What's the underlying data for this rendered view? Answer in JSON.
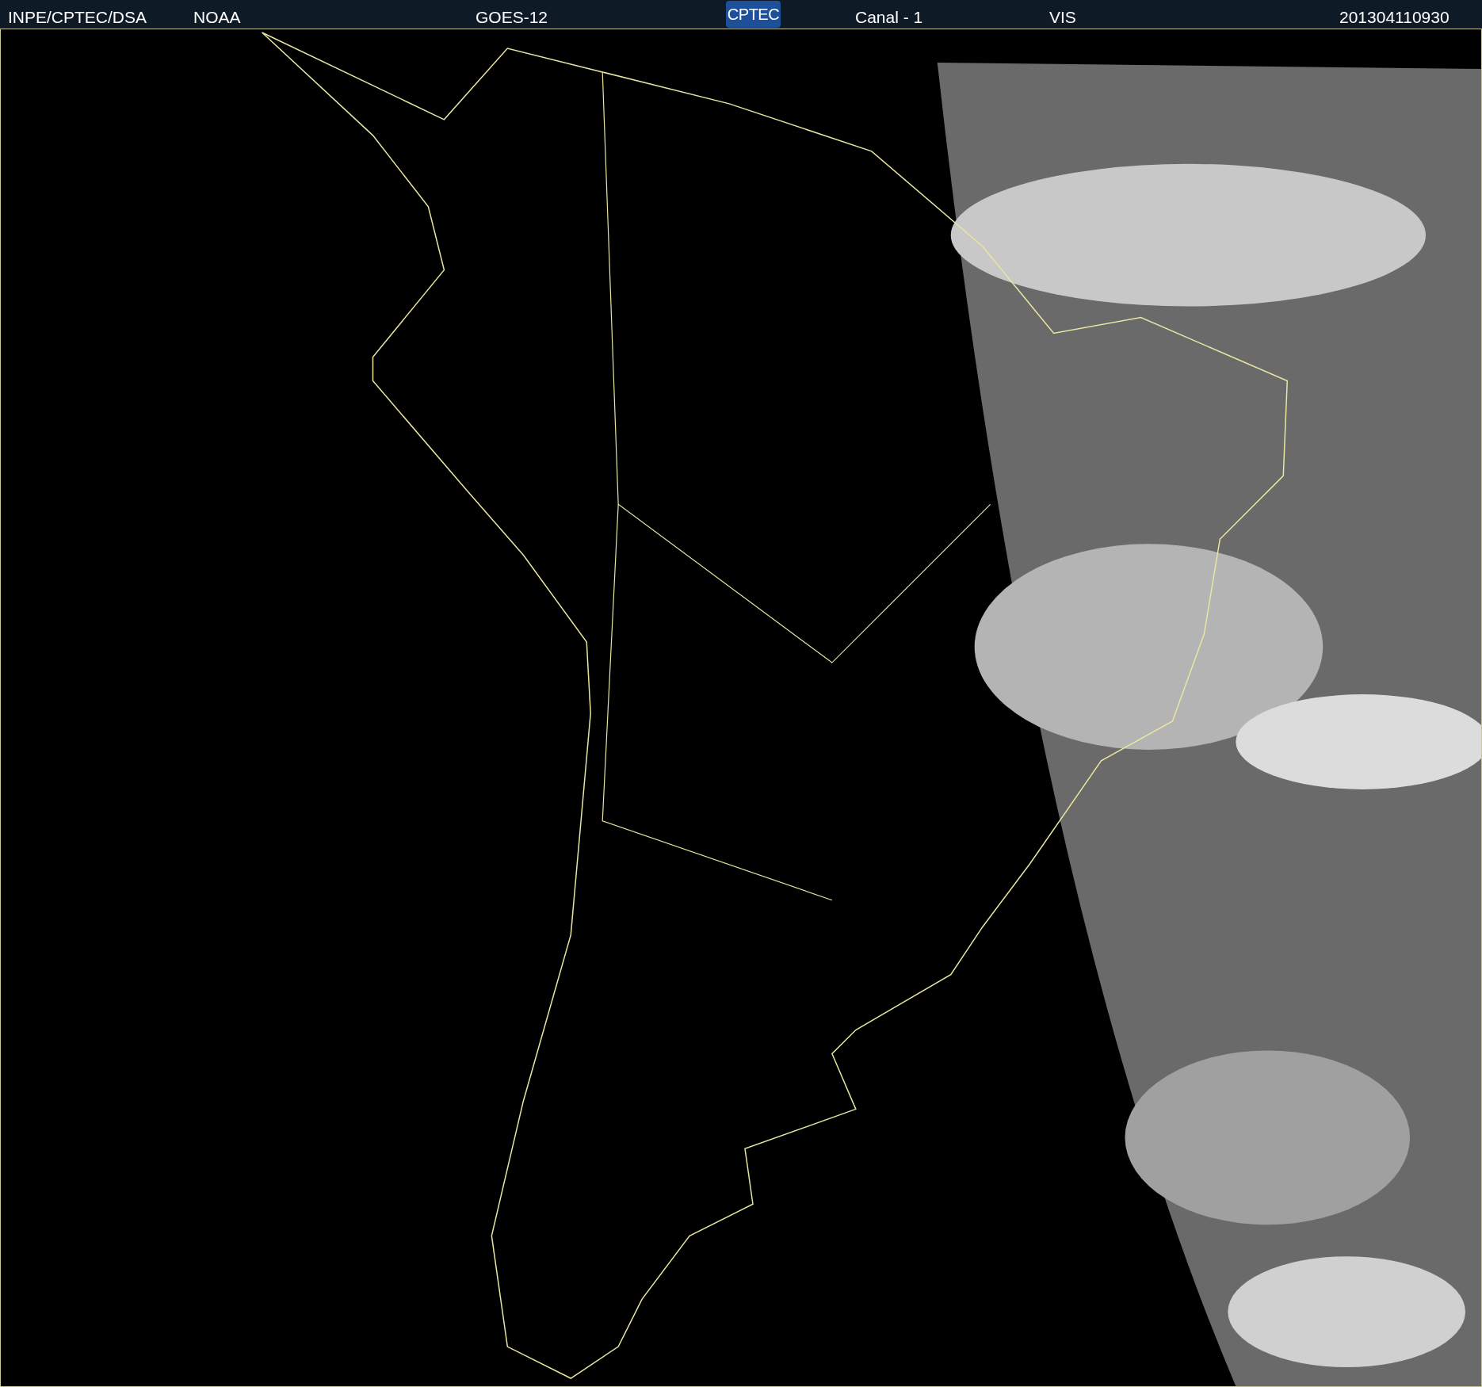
{
  "header": {
    "items": [
      {
        "kind": "text",
        "text": "INPE/CPTEC/DSA"
      },
      {
        "kind": "text",
        "text": "NOAA"
      },
      {
        "kind": "text",
        "text": "GOES-12"
      },
      {
        "kind": "logo",
        "text": "CPTEC"
      },
      {
        "kind": "text",
        "text": "Canal - 1"
      },
      {
        "kind": "text",
        "text": "VIS"
      },
      {
        "kind": "text",
        "text": "201304110930"
      }
    ]
  }
}
